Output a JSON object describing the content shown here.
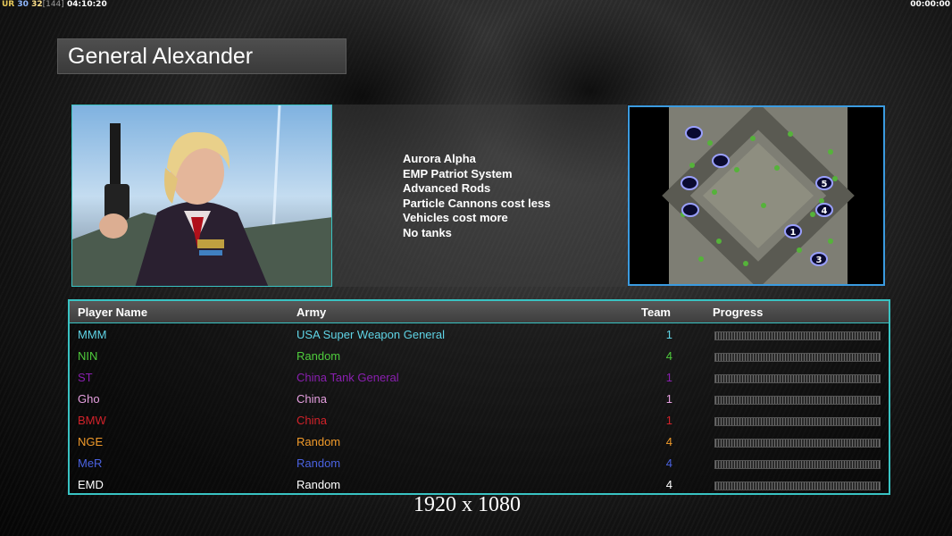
{
  "hud": {
    "left_a": "UR",
    "left_b": "30",
    "left_c": "32",
    "left_d": "[144]",
    "left_time": "04:10:20",
    "right_time": "00:00:00"
  },
  "general": {
    "name": "General Alexander",
    "traits": [
      "Aurora Alpha",
      "EMP Patriot System",
      "Advanced Rods",
      "Particle Cannons cost less",
      "Vehicles cost more",
      "No tanks"
    ]
  },
  "minimap": {
    "start_positions": [
      "1",
      "3",
      "4",
      "5"
    ]
  },
  "table": {
    "headers": {
      "player": "Player Name",
      "army": "Army",
      "team": "Team",
      "progress": "Progress"
    },
    "rows": [
      {
        "name": "MMM",
        "army": "USA Super Weapon General",
        "team": "1",
        "color": "#5fd4e6"
      },
      {
        "name": "NIN",
        "army": "Random",
        "team": "4",
        "color": "#4ecb3c"
      },
      {
        "name": "ST",
        "army": "China Tank General",
        "team": "1",
        "color": "#8a1fb0"
      },
      {
        "name": "Gho",
        "army": "China",
        "team": "1",
        "color": "#e6a0e0"
      },
      {
        "name": "BMW",
        "army": "China",
        "team": "1",
        "color": "#d2222a"
      },
      {
        "name": "NGE",
        "army": "Random",
        "team": "4",
        "color": "#f09a2a"
      },
      {
        "name": "MeR",
        "army": "Random",
        "team": "4",
        "color": "#4a62e0"
      },
      {
        "name": "EMD",
        "army": "Random",
        "team": "4",
        "color": "#ffffff"
      }
    ]
  },
  "resolution_text": "1920 x 1080",
  "colors": {
    "border_cyan": "#39c3c3",
    "minimap_border": "#3b9be0"
  }
}
